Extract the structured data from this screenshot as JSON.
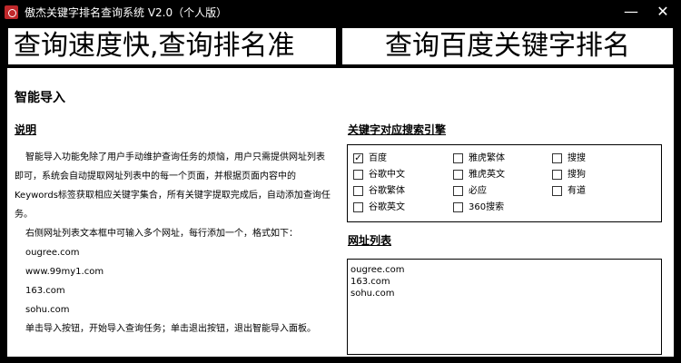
{
  "window": {
    "title": "傲杰关键字排名查询系统 V2.0（个人版）",
    "minimize": "—",
    "close": "✕"
  },
  "banners": {
    "left": "查询速度快,查询排名准",
    "right": "查询百度关键字排名"
  },
  "panel": {
    "title": "智能导入",
    "description": {
      "heading": "说明",
      "lines": [
        "智能导入功能免除了用户手动维护查询任务的烦恼，用户只需提供网址列表",
        "即可，系统会自动提取网址列表中的每一个页面，并根据页面内容中的",
        "Keywords标签获取相应关键字集合，所有关键字提取完成后，自动添加查询任",
        "务。",
        "右侧网址列表文本框中可输入多个网址，每行添加一个，格式如下：",
        "ougree.com",
        "www.99my1.com",
        "163.com",
        "sohu.com",
        "单击导入按钮，开始导入查询任务；单击退出按钮，退出智能导入面板。"
      ]
    },
    "engines": {
      "heading": "关键字对应搜索引擎",
      "options": [
        {
          "label": "百度",
          "checked": true
        },
        {
          "label": "谷歌中文",
          "checked": false
        },
        {
          "label": "谷歌繁体",
          "checked": false
        },
        {
          "label": "谷歌英文",
          "checked": false
        },
        {
          "label": "雅虎繁体",
          "checked": false
        },
        {
          "label": "雅虎英文",
          "checked": false
        },
        {
          "label": "必应",
          "checked": false
        },
        {
          "label": "360搜索",
          "checked": false
        },
        {
          "label": "搜搜",
          "checked": false
        },
        {
          "label": "搜狗",
          "checked": false
        },
        {
          "label": "有道",
          "checked": false
        }
      ]
    },
    "urls": {
      "heading": "网址列表",
      "items": [
        "ougree.com",
        "163.com",
        "sohu.com"
      ]
    }
  }
}
